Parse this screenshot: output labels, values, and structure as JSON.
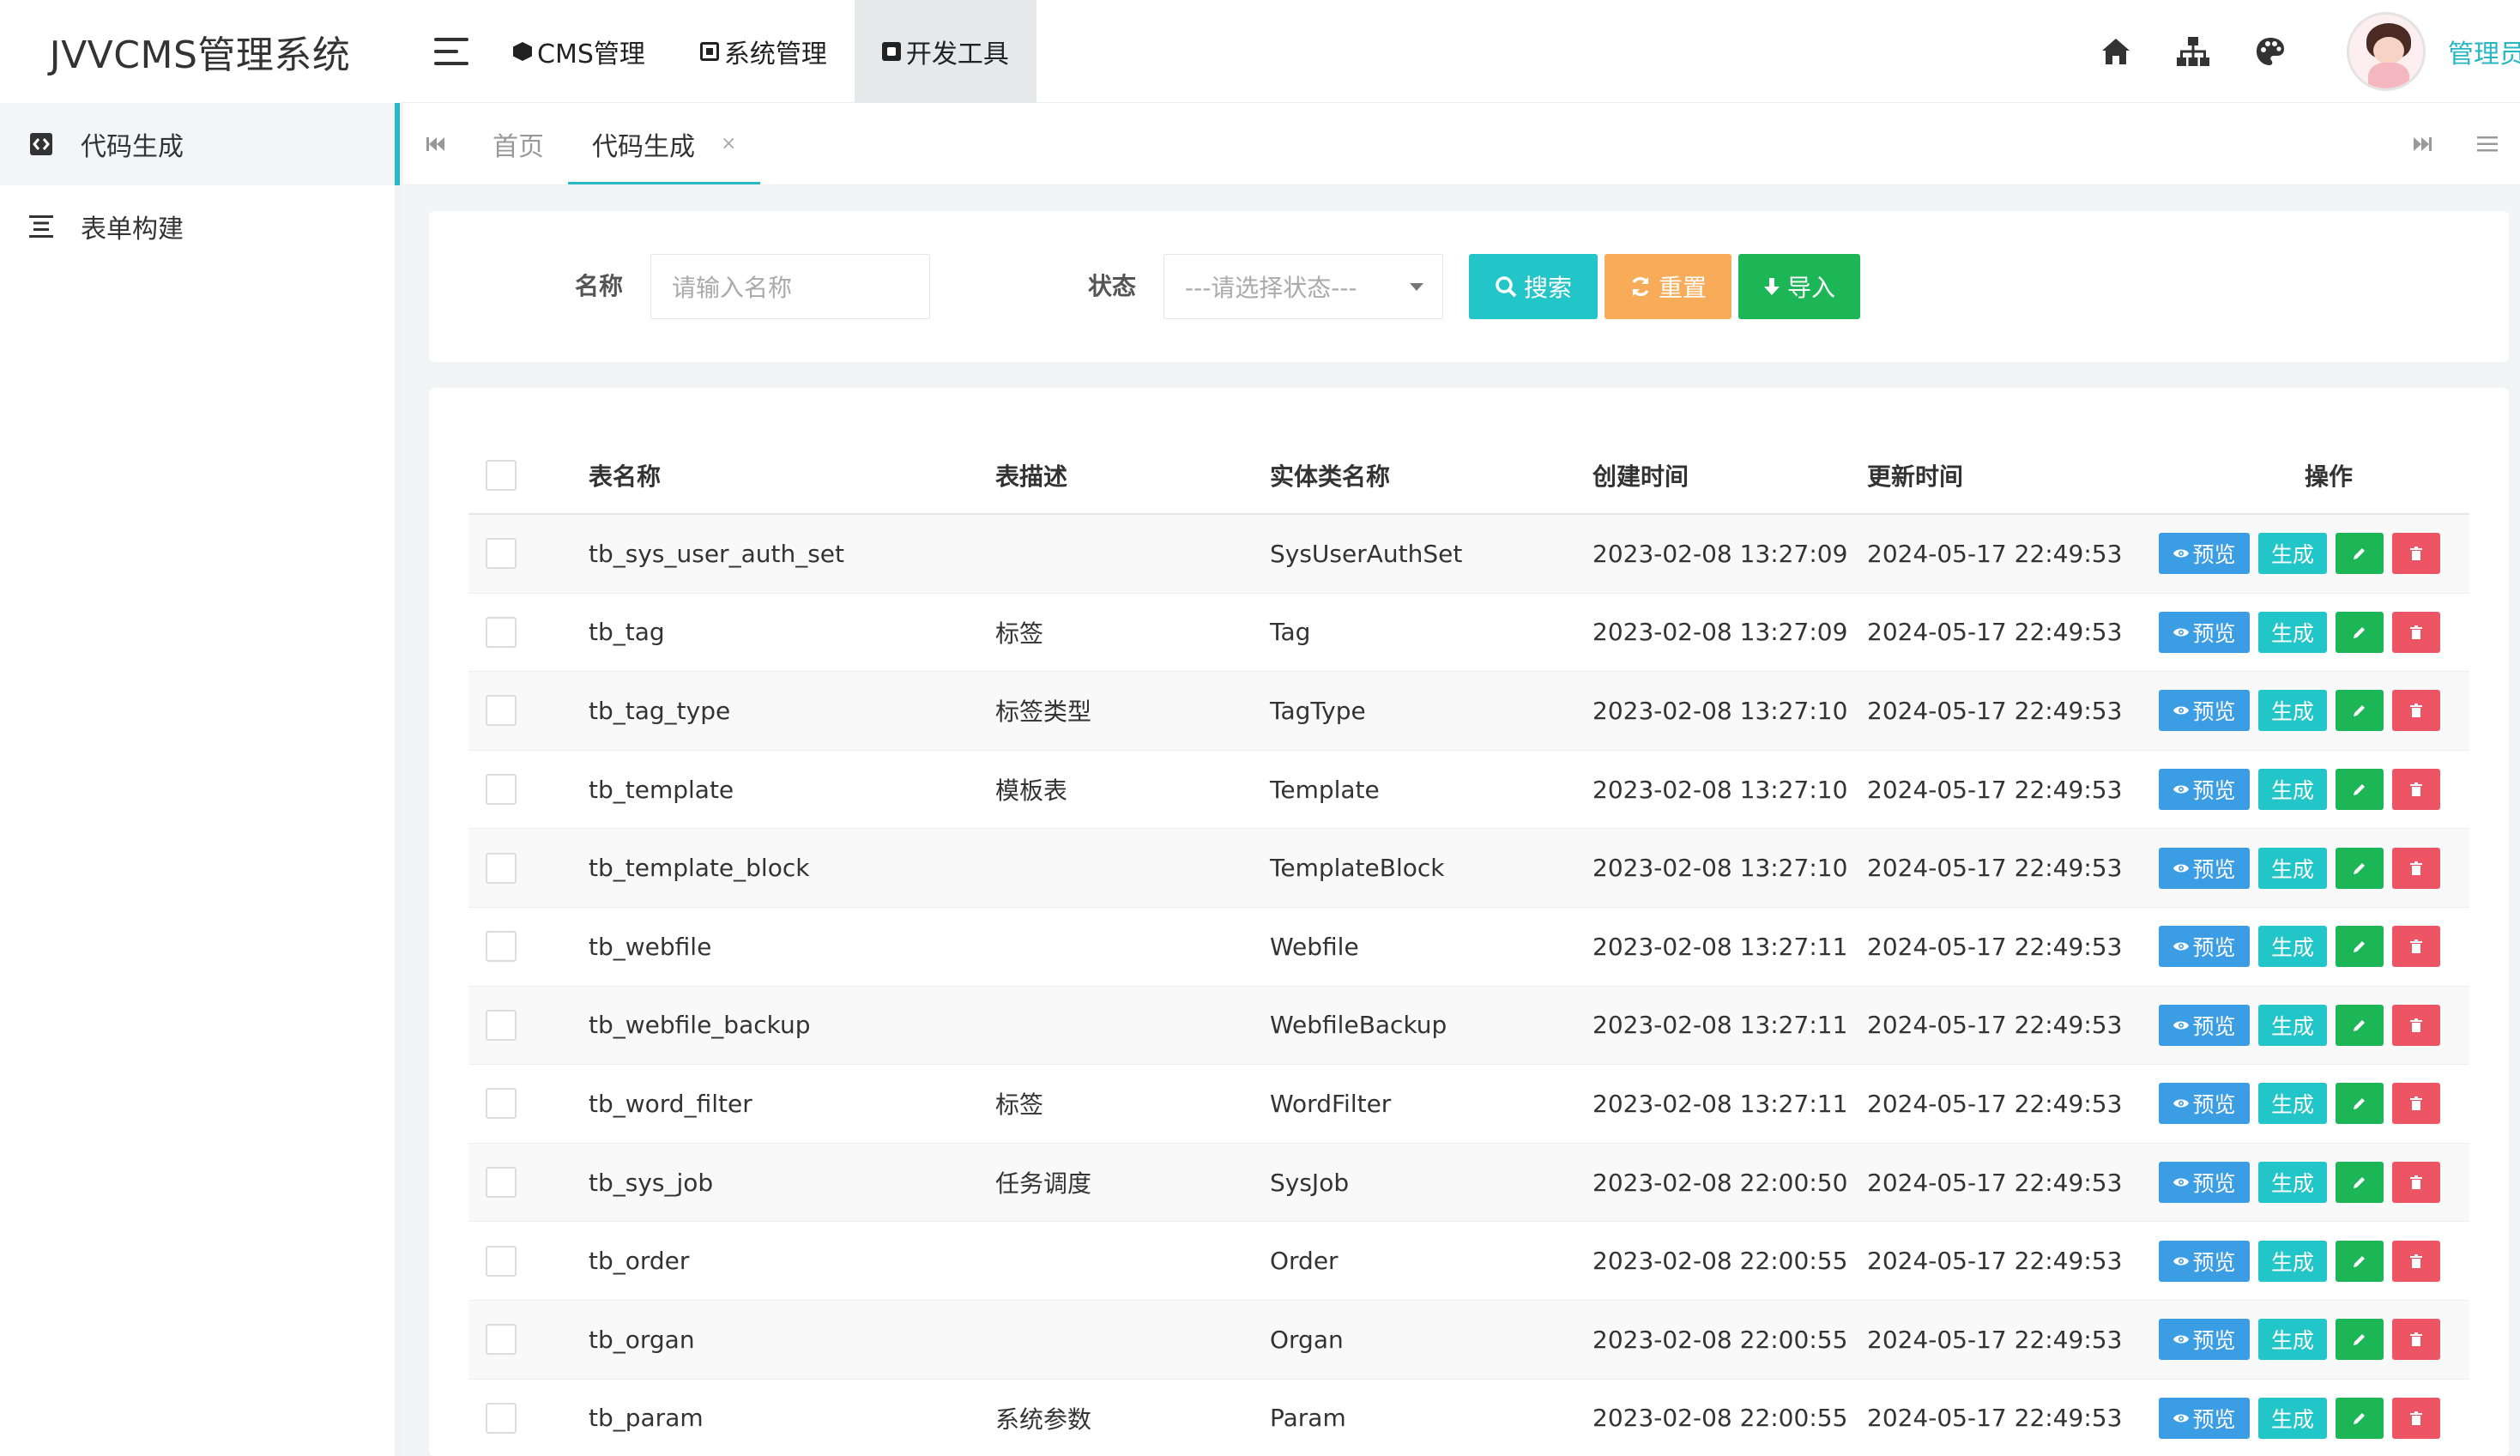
{
  "app": {
    "title": "JVVCMS管理系统"
  },
  "topnav": {
    "items": [
      {
        "label": "CMS管理",
        "icon": "cube-icon"
      },
      {
        "label": "系统管理",
        "icon": "settings-box-icon"
      },
      {
        "label": "开发工具",
        "icon": "tool-box-icon",
        "active": true
      }
    ],
    "right_icons": [
      "home-icon",
      "sitemap-icon",
      "palette-icon"
    ],
    "username": "管理员"
  },
  "sidebar": {
    "items": [
      {
        "label": "代码生成",
        "icon": "code-icon",
        "active": true
      },
      {
        "label": "表单构建",
        "icon": "align-icon"
      }
    ]
  },
  "tabs": {
    "items": [
      {
        "label": "首页"
      },
      {
        "label": "代码生成",
        "active": true,
        "close": "×"
      }
    ]
  },
  "search": {
    "name_label": "名称",
    "name_placeholder": "请输入名称",
    "status_label": "状态",
    "status_placeholder": "---请选择状态---",
    "search_button": "搜索",
    "reset_button": "重置",
    "import_button": "导入"
  },
  "table": {
    "headers": {
      "name": "表名称",
      "desc": "表描述",
      "entity": "实体类名称",
      "created": "创建时间",
      "updated": "更新时间",
      "ops": "操作"
    },
    "op_labels": {
      "view": "预览",
      "gen": "生成"
    },
    "rows": [
      {
        "name": "tb_sys_user_auth_set",
        "desc": "",
        "entity": "SysUserAuthSet",
        "created": "2023-02-08 13:27:09",
        "updated": "2024-05-17 22:49:53"
      },
      {
        "name": "tb_tag",
        "desc": "标签",
        "entity": "Tag",
        "created": "2023-02-08 13:27:09",
        "updated": "2024-05-17 22:49:53"
      },
      {
        "name": "tb_tag_type",
        "desc": "标签类型",
        "entity": "TagType",
        "created": "2023-02-08 13:27:10",
        "updated": "2024-05-17 22:49:53"
      },
      {
        "name": "tb_template",
        "desc": "模板表",
        "entity": "Template",
        "created": "2023-02-08 13:27:10",
        "updated": "2024-05-17 22:49:53"
      },
      {
        "name": "tb_template_block",
        "desc": "",
        "entity": "TemplateBlock",
        "created": "2023-02-08 13:27:10",
        "updated": "2024-05-17 22:49:53"
      },
      {
        "name": "tb_webfile",
        "desc": "",
        "entity": "Webfile",
        "created": "2023-02-08 13:27:11",
        "updated": "2024-05-17 22:49:53"
      },
      {
        "name": "tb_webfile_backup",
        "desc": "",
        "entity": "WebfileBackup",
        "created": "2023-02-08 13:27:11",
        "updated": "2024-05-17 22:49:53"
      },
      {
        "name": "tb_word_filter",
        "desc": "标签",
        "entity": "WordFilter",
        "created": "2023-02-08 13:27:11",
        "updated": "2024-05-17 22:49:53"
      },
      {
        "name": "tb_sys_job",
        "desc": "任务调度",
        "entity": "SysJob",
        "created": "2023-02-08 22:00:50",
        "updated": "2024-05-17 22:49:53"
      },
      {
        "name": "tb_order",
        "desc": "",
        "entity": "Order",
        "created": "2023-02-08 22:00:55",
        "updated": "2024-05-17 22:49:53"
      },
      {
        "name": "tb_organ",
        "desc": "",
        "entity": "Organ",
        "created": "2023-02-08 22:00:55",
        "updated": "2024-05-17 22:49:53"
      },
      {
        "name": "tb_param",
        "desc": "系统参数",
        "entity": "Param",
        "created": "2023-02-08 22:00:55",
        "updated": "2024-05-17 22:49:53"
      }
    ]
  },
  "colors": {
    "accent": "#23c6c8",
    "view": "#3b9de4",
    "reset": "#f8ac59",
    "import": "#1cb657",
    "delete": "#ed5565",
    "username": "#27b7c4"
  }
}
